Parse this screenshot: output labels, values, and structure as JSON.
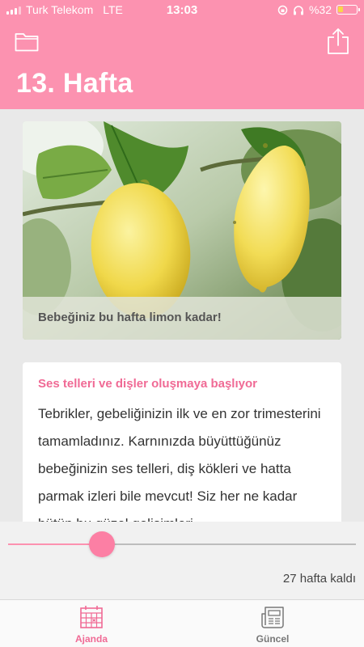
{
  "status_bar": {
    "carrier": "Turk Telekom",
    "network": "LTE",
    "time": "13:03",
    "battery_text": "%32",
    "battery_level": 0.32
  },
  "header": {
    "title": "13. Hafta",
    "folder_icon": "folder-icon",
    "share_icon": "share-icon",
    "background_color": "#fc92b0"
  },
  "image_card": {
    "image": "lemons-photo",
    "caption": "Bebeğiniz bu hafta limon kadar!"
  },
  "article": {
    "heading": "Ses telleri ve dişler oluşmaya başlıyor",
    "body": "Tebrikler, gebeliğinizin ilk ve en zor trimesterini tamamladınız. Karnınızda büyüttüğünüz bebeğinizin ses telleri, diş kökleri ve hatta parmak izleri bile mevcut! Siz her ne kadar bütün bu güzel gelişimleri"
  },
  "week_slider": {
    "position": 0.27,
    "remaining_label": "27 hafta kaldı",
    "accent_color": "#fc7fa4"
  },
  "tab_bar": {
    "tabs": [
      {
        "label": "Ajanda",
        "icon": "calendar-icon",
        "active": true
      },
      {
        "label": "Güncel",
        "icon": "newspaper-icon",
        "active": false
      }
    ],
    "active_color": "#f06a95"
  }
}
